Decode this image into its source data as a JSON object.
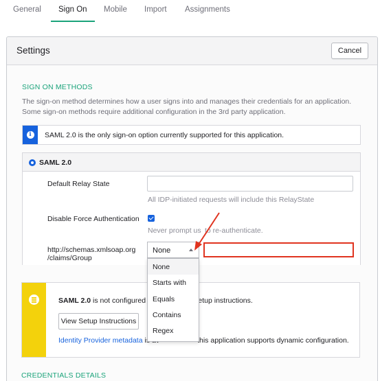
{
  "tabs": [
    "General",
    "Sign On",
    "Mobile",
    "Import",
    "Assignments"
  ],
  "settings": {
    "title": "Settings",
    "cancel_label": "Cancel"
  },
  "sign_on_methods": {
    "heading": "SIGN ON METHODS",
    "description": "The sign-on method determines how a user signs into and manages their credentials for an application. Some sign-on methods require additional configuration in the 3rd party application.",
    "info_text": "SAML 2.0 is the only sign-on option currently supported for this application.",
    "option_label": "SAML 2.0"
  },
  "fields": {
    "relay_state_label": "Default Relay State",
    "relay_state_value": "",
    "relay_state_helper": "All IDP-initiated requests will include this RelayState",
    "disable_force_auth_label": "Disable Force Authentication",
    "disable_force_auth_checked": true,
    "disable_force_auth_helper": "Never prompt us",
    "disable_force_auth_helper_tail": "to re-authenticate.",
    "group_claim_label_1": "http://schemas.xmlsoap.org",
    "group_claim_label_2": "/claims/Group",
    "group_filter_selected": "None",
    "group_filter_options": [
      "None",
      "Starts with",
      "Equals",
      "Contains",
      "Regex"
    ],
    "group_filter_value": ""
  },
  "warning": {
    "text_bold": "SAML 2.0",
    "text_mid": " is not configured unt",
    "text_tail": "he setup instructions.",
    "button_label": "View Setup Instructions",
    "link_text": "Identity Provider metadata",
    "footer_mid": " is av",
    "footer_tail": "this application supports dynamic configuration."
  },
  "credentials_heading": "CREDENTIALS DETAILS",
  "colors": {
    "accent_green": "#1aa37a",
    "primary_blue": "#1662dd",
    "warning_yellow": "#f3d20c",
    "annotation_red": "#e0331f"
  }
}
